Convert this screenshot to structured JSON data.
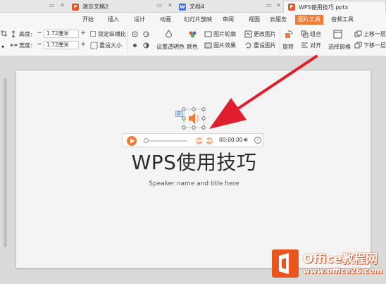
{
  "tabs": [
    {
      "label": "演示文稿2",
      "icon": "ppt-doc-icon"
    },
    {
      "label": "文档4",
      "icon": "wps-doc-icon"
    },
    {
      "label": "WPS使用技巧.pptx",
      "icon": "ppt-doc-icon"
    }
  ],
  "menu": [
    "开始",
    "插入",
    "设计",
    "动画",
    "幻灯片放映",
    "审阅",
    "视图",
    "云服务",
    "图片工具",
    "音频工具"
  ],
  "toolbar": {
    "height_label": "高度:",
    "height_value": "1.72厘米",
    "width_label": "宽度:",
    "width_value": "1.72厘米",
    "lock_ratio": "锁定纵横比",
    "reset_size": "重设大小",
    "set_transparent": "设置透明色",
    "color": "颜色",
    "picture_outline": "图片轮廓",
    "picture_effect": "图片效果",
    "change_picture": "更改图片",
    "reset_picture": "重设图片",
    "rotate": "旋转",
    "combine": "组合",
    "align": "对齐",
    "selection_pane": "选择窗格",
    "bring_forward": "上移一层",
    "send_backward": "下移一层"
  },
  "player": {
    "time": "00:00.00"
  },
  "slide": {
    "title": "WPS使用技巧",
    "subtitle": "Speaker name and title here",
    "selection_badge": "0"
  },
  "watermark": {
    "line1": "Office教程网",
    "line2": "www.office26.com"
  },
  "colors": {
    "accent": "#f07b36",
    "arrow": "#e01e2d",
    "watermark": "#e8561e"
  }
}
